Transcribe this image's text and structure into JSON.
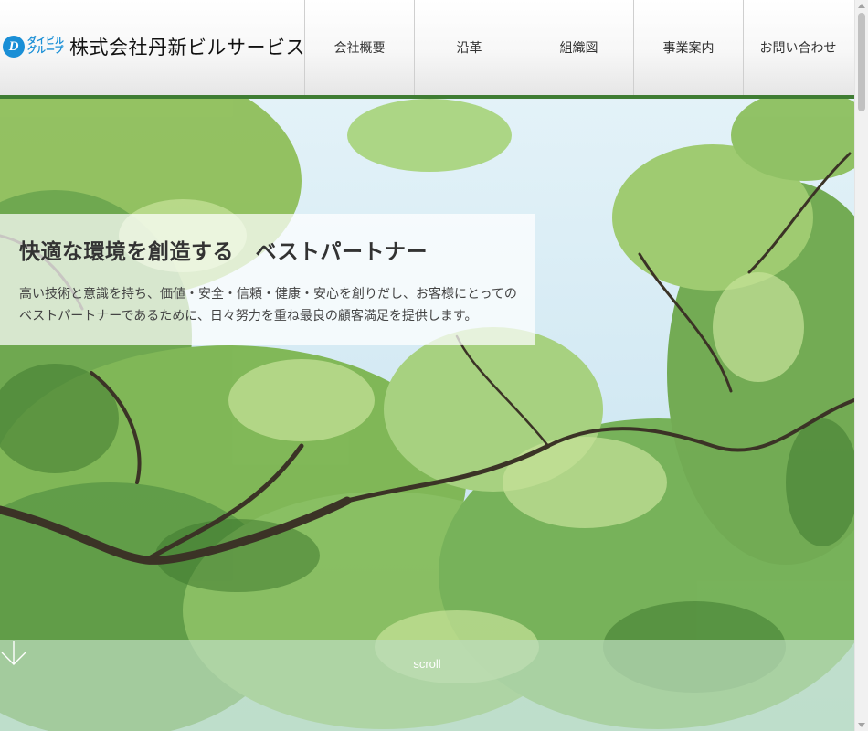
{
  "header": {
    "logo": {
      "mark": "D",
      "group_line1": "ダイビル",
      "group_line2": "グループ"
    },
    "company_name": "株式会社丹新ビルサービス"
  },
  "nav": {
    "items": [
      {
        "label": "会社概要"
      },
      {
        "label": "沿革"
      },
      {
        "label": "組織図"
      },
      {
        "label": "事業案内"
      },
      {
        "label": "お問い合わせ"
      }
    ]
  },
  "hero": {
    "title": "快適な環境を創造する　ベストパートナー",
    "description_line1": "高い技術と意識を持ち、価値・安全・信頼・健康・安心を創りだし、お客様にとっての",
    "description_line2": "ベストパートナーであるために、日々努力を重ね最良の顧客満足を提供します。",
    "scroll_label": "scroll"
  },
  "colors": {
    "accent_green": "#3f7d33",
    "logo_blue": "#1a8fd6",
    "sky": "#cfe7f3"
  }
}
